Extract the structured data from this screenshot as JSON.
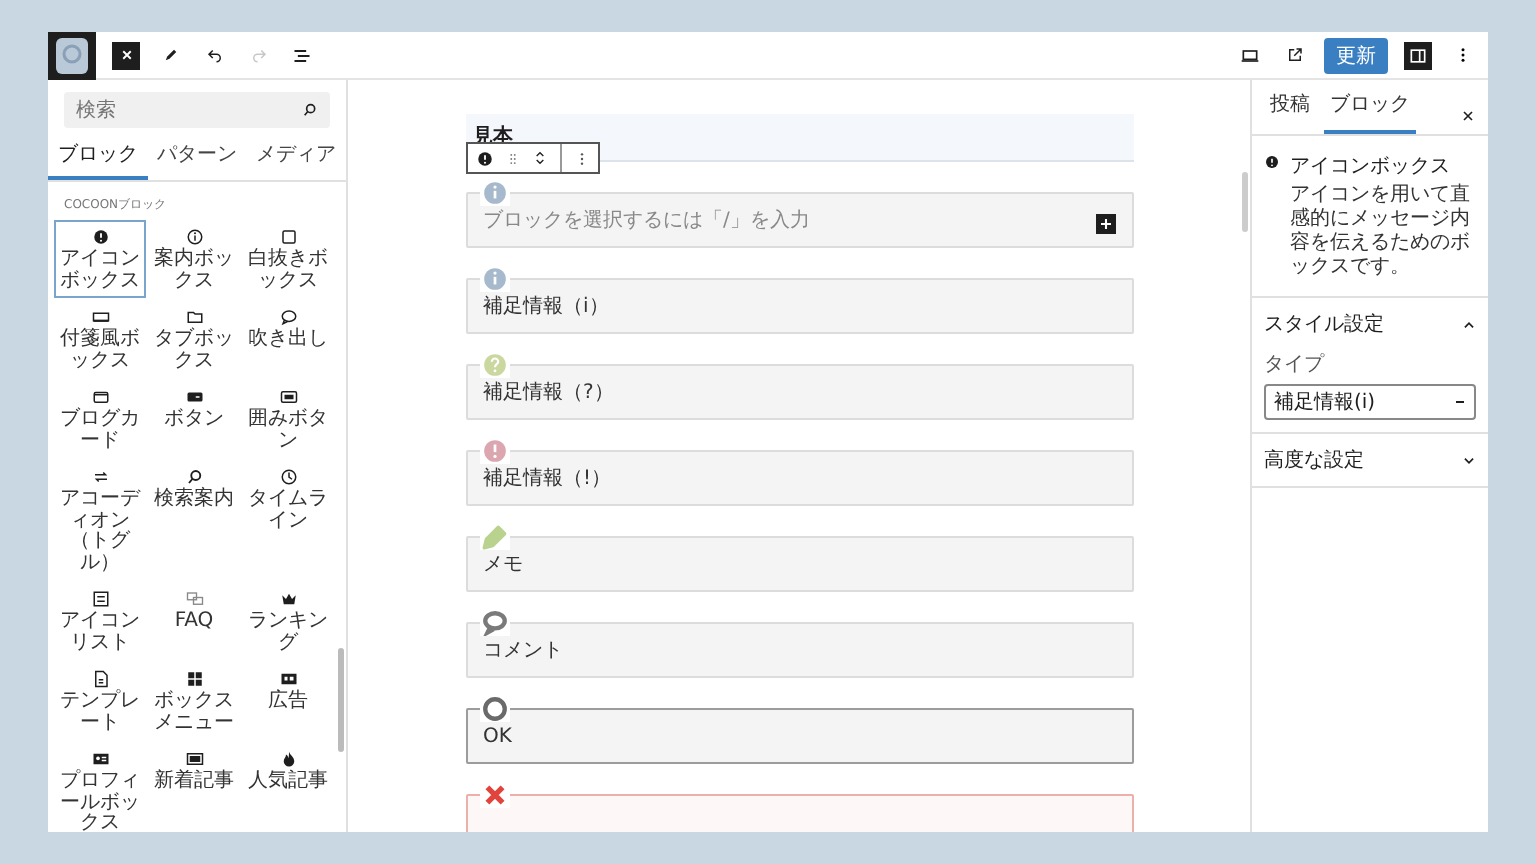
{
  "topbar": {
    "redo_disabled": true,
    "update_label": "更新",
    "sidebar_pressed": true
  },
  "inserter": {
    "search": {
      "placeholder": "検索"
    },
    "tabs": [
      {
        "label": "ブロック",
        "selected": true
      },
      {
        "label": "パターン",
        "selected": false
      },
      {
        "label": "メディア",
        "selected": false
      }
    ],
    "category": "COCOONブロック",
    "blocks": [
      {
        "label": "アイコンボックス",
        "selected": true
      },
      {
        "label": "案内ボックス",
        "selected": false
      },
      {
        "label": "白抜きボックス",
        "selected": false
      },
      {
        "label": "付箋風ボックス",
        "selected": false
      },
      {
        "label": "タブボックス",
        "selected": false
      },
      {
        "label": "吹き出し",
        "selected": false
      },
      {
        "label": "ブログカード",
        "selected": false
      },
      {
        "label": "ボタン",
        "selected": false
      },
      {
        "label": "囲みボタン",
        "selected": false
      },
      {
        "label": "アコーディオン（トグル）",
        "selected": false
      },
      {
        "label": "検索案内",
        "selected": false
      },
      {
        "label": "タイムライン",
        "selected": false
      },
      {
        "label": "アイコンリスト",
        "selected": false
      },
      {
        "label": "FAQ",
        "selected": false
      },
      {
        "label": "ランキング",
        "selected": false
      },
      {
        "label": "テンプレート",
        "selected": false
      },
      {
        "label": "ボックスメニュー",
        "selected": false
      },
      {
        "label": "広告",
        "selected": false
      },
      {
        "label": "プロフィールボックス",
        "selected": false
      },
      {
        "label": "新着記事",
        "selected": false
      },
      {
        "label": "人気記事",
        "selected": false
      }
    ]
  },
  "editor": {
    "heading": "見本",
    "boxes": [
      {
        "kind": "info",
        "placeholder": "ブロックを選択するには「/」を入力",
        "color": "#a7b9cc"
      },
      {
        "kind": "info",
        "text": "補足情報（i）",
        "color": "#a7b9cc"
      },
      {
        "kind": "question",
        "text": "補足情報（?）",
        "color": "#cad79f"
      },
      {
        "kind": "alert",
        "text": "補足情報（!）",
        "color": "#dba6b0"
      },
      {
        "kind": "memo",
        "text": "メモ",
        "color": "#b9d28e"
      },
      {
        "kind": "comment",
        "text": "コメント",
        "color": "#7a7a7a"
      },
      {
        "kind": "ok",
        "text": "OK",
        "color": "#6a6a6a"
      },
      {
        "kind": "bad",
        "color": "#e0443c"
      }
    ]
  },
  "sidebar": {
    "tabs": [
      {
        "label": "投稿",
        "selected": false
      },
      {
        "label": "ブロック",
        "selected": true
      }
    ],
    "block": {
      "title": "アイコンボックス",
      "description": "アイコンを用いて直感的にメッセージ内容を伝えるためのボックスです。"
    },
    "panels": [
      {
        "title": "スタイル設定",
        "expanded": true,
        "field": {
          "label": "タイプ",
          "value": "補足情報(i)"
        }
      },
      {
        "title": "高度な設定",
        "expanded": false
      }
    ]
  }
}
